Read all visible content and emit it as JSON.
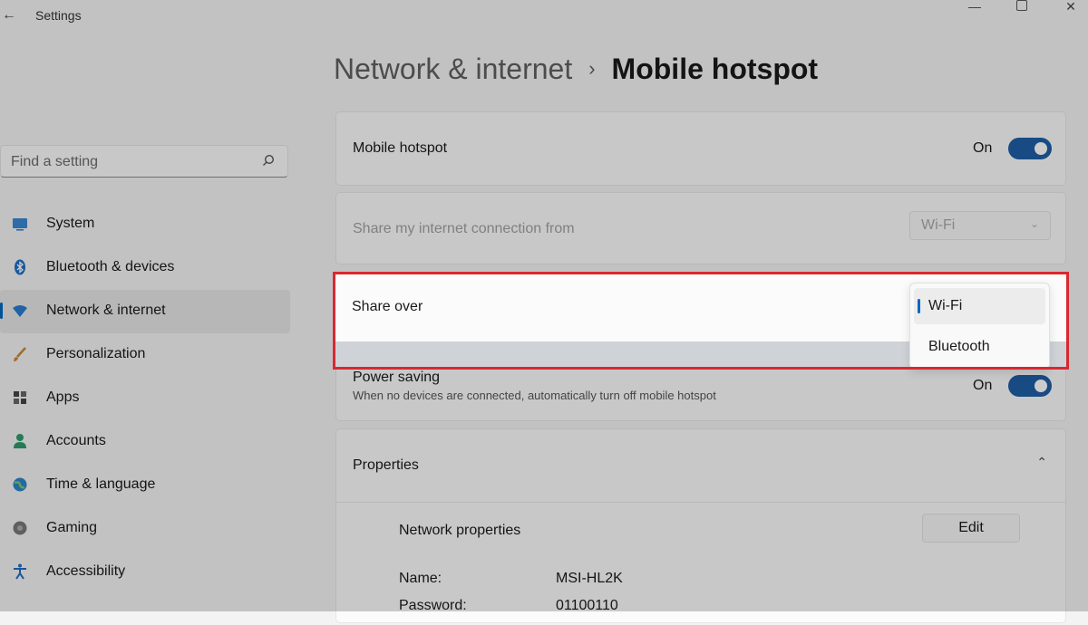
{
  "window": {
    "title": "Settings",
    "back_glyph": "←",
    "minimize_glyph": "—",
    "close_glyph": "✕"
  },
  "search": {
    "placeholder": "Find a setting"
  },
  "sidebar": {
    "items": [
      {
        "label": "System",
        "icon": "system-icon"
      },
      {
        "label": "Bluetooth & devices",
        "icon": "bluetooth-icon"
      },
      {
        "label": "Network & internet",
        "icon": "network-icon",
        "active": true
      },
      {
        "label": "Personalization",
        "icon": "brush-icon"
      },
      {
        "label": "Apps",
        "icon": "apps-icon"
      },
      {
        "label": "Accounts",
        "icon": "accounts-icon"
      },
      {
        "label": "Time & language",
        "icon": "globe-icon"
      },
      {
        "label": "Gaming",
        "icon": "gaming-icon"
      },
      {
        "label": "Accessibility",
        "icon": "accessibility-icon"
      }
    ]
  },
  "breadcrumb": {
    "parent": "Network & internet",
    "separator": "›",
    "current": "Mobile hotspot"
  },
  "hotspot": {
    "label": "Mobile hotspot",
    "state": "On"
  },
  "share_from": {
    "label": "Share my internet connection from",
    "value": "Wi-Fi",
    "chevron": "⌄"
  },
  "share_over": {
    "label": "Share over",
    "options": [
      "Wi-Fi",
      "Bluetooth"
    ],
    "selected": "Wi-Fi"
  },
  "power_saving": {
    "label": "Power saving",
    "description": "When no devices are connected, automatically turn off mobile hotspot",
    "state": "On"
  },
  "properties": {
    "label": "Properties",
    "chevron": "⌃",
    "network_properties": "Network properties",
    "edit_label": "Edit",
    "name_label": "Name:",
    "name_value": "MSI-HL2K",
    "password_label": "Password:",
    "password_value": "01100110"
  },
  "colors": {
    "accent": "#0067c0",
    "toggle_on": "#1e5ea6",
    "highlight": "#d9282f"
  }
}
